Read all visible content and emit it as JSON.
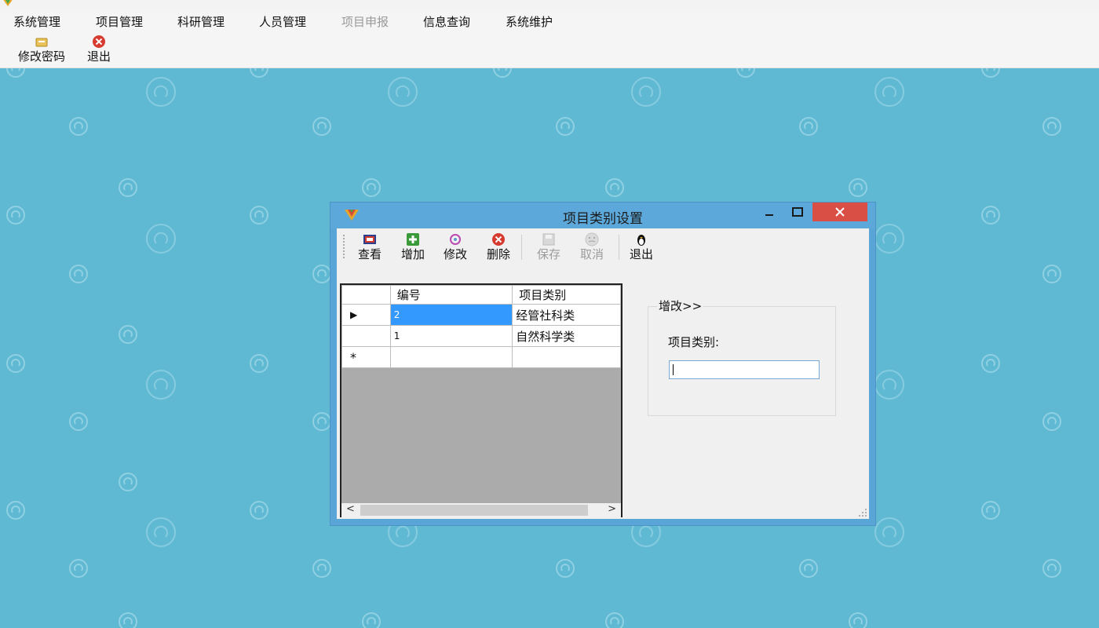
{
  "menubar": {
    "items": [
      {
        "label": "系统管理",
        "enabled": true
      },
      {
        "label": "项目管理",
        "enabled": true
      },
      {
        "label": "科研管理",
        "enabled": true
      },
      {
        "label": "人员管理",
        "enabled": true
      },
      {
        "label": "项目申报",
        "enabled": false
      },
      {
        "label": "信息查询",
        "enabled": true
      },
      {
        "label": "系统维护",
        "enabled": true
      }
    ]
  },
  "toolbar": {
    "change_password": "修改密码",
    "exit": "退出"
  },
  "dialog": {
    "title": "项目类别设置",
    "toolbar": {
      "view": "查看",
      "add": "增加",
      "edit": "修改",
      "delete": "删除",
      "save": "保存",
      "cancel": "取消",
      "exit": "退出"
    },
    "grid": {
      "columns": [
        "编号",
        "项目类别"
      ],
      "rows": [
        {
          "id": "2",
          "category": "经管社科类"
        },
        {
          "id": "1",
          "category": "自然科学类"
        }
      ],
      "new_row_marker": "*"
    },
    "form": {
      "group_title": "增改>>",
      "category_label": "项目类别:",
      "category_value": ""
    }
  },
  "colors": {
    "desktop": "#60b9d3",
    "dialog_border": "#5aa5d8",
    "close_button": "#d94f45",
    "selected_cell": "#3399ff"
  }
}
